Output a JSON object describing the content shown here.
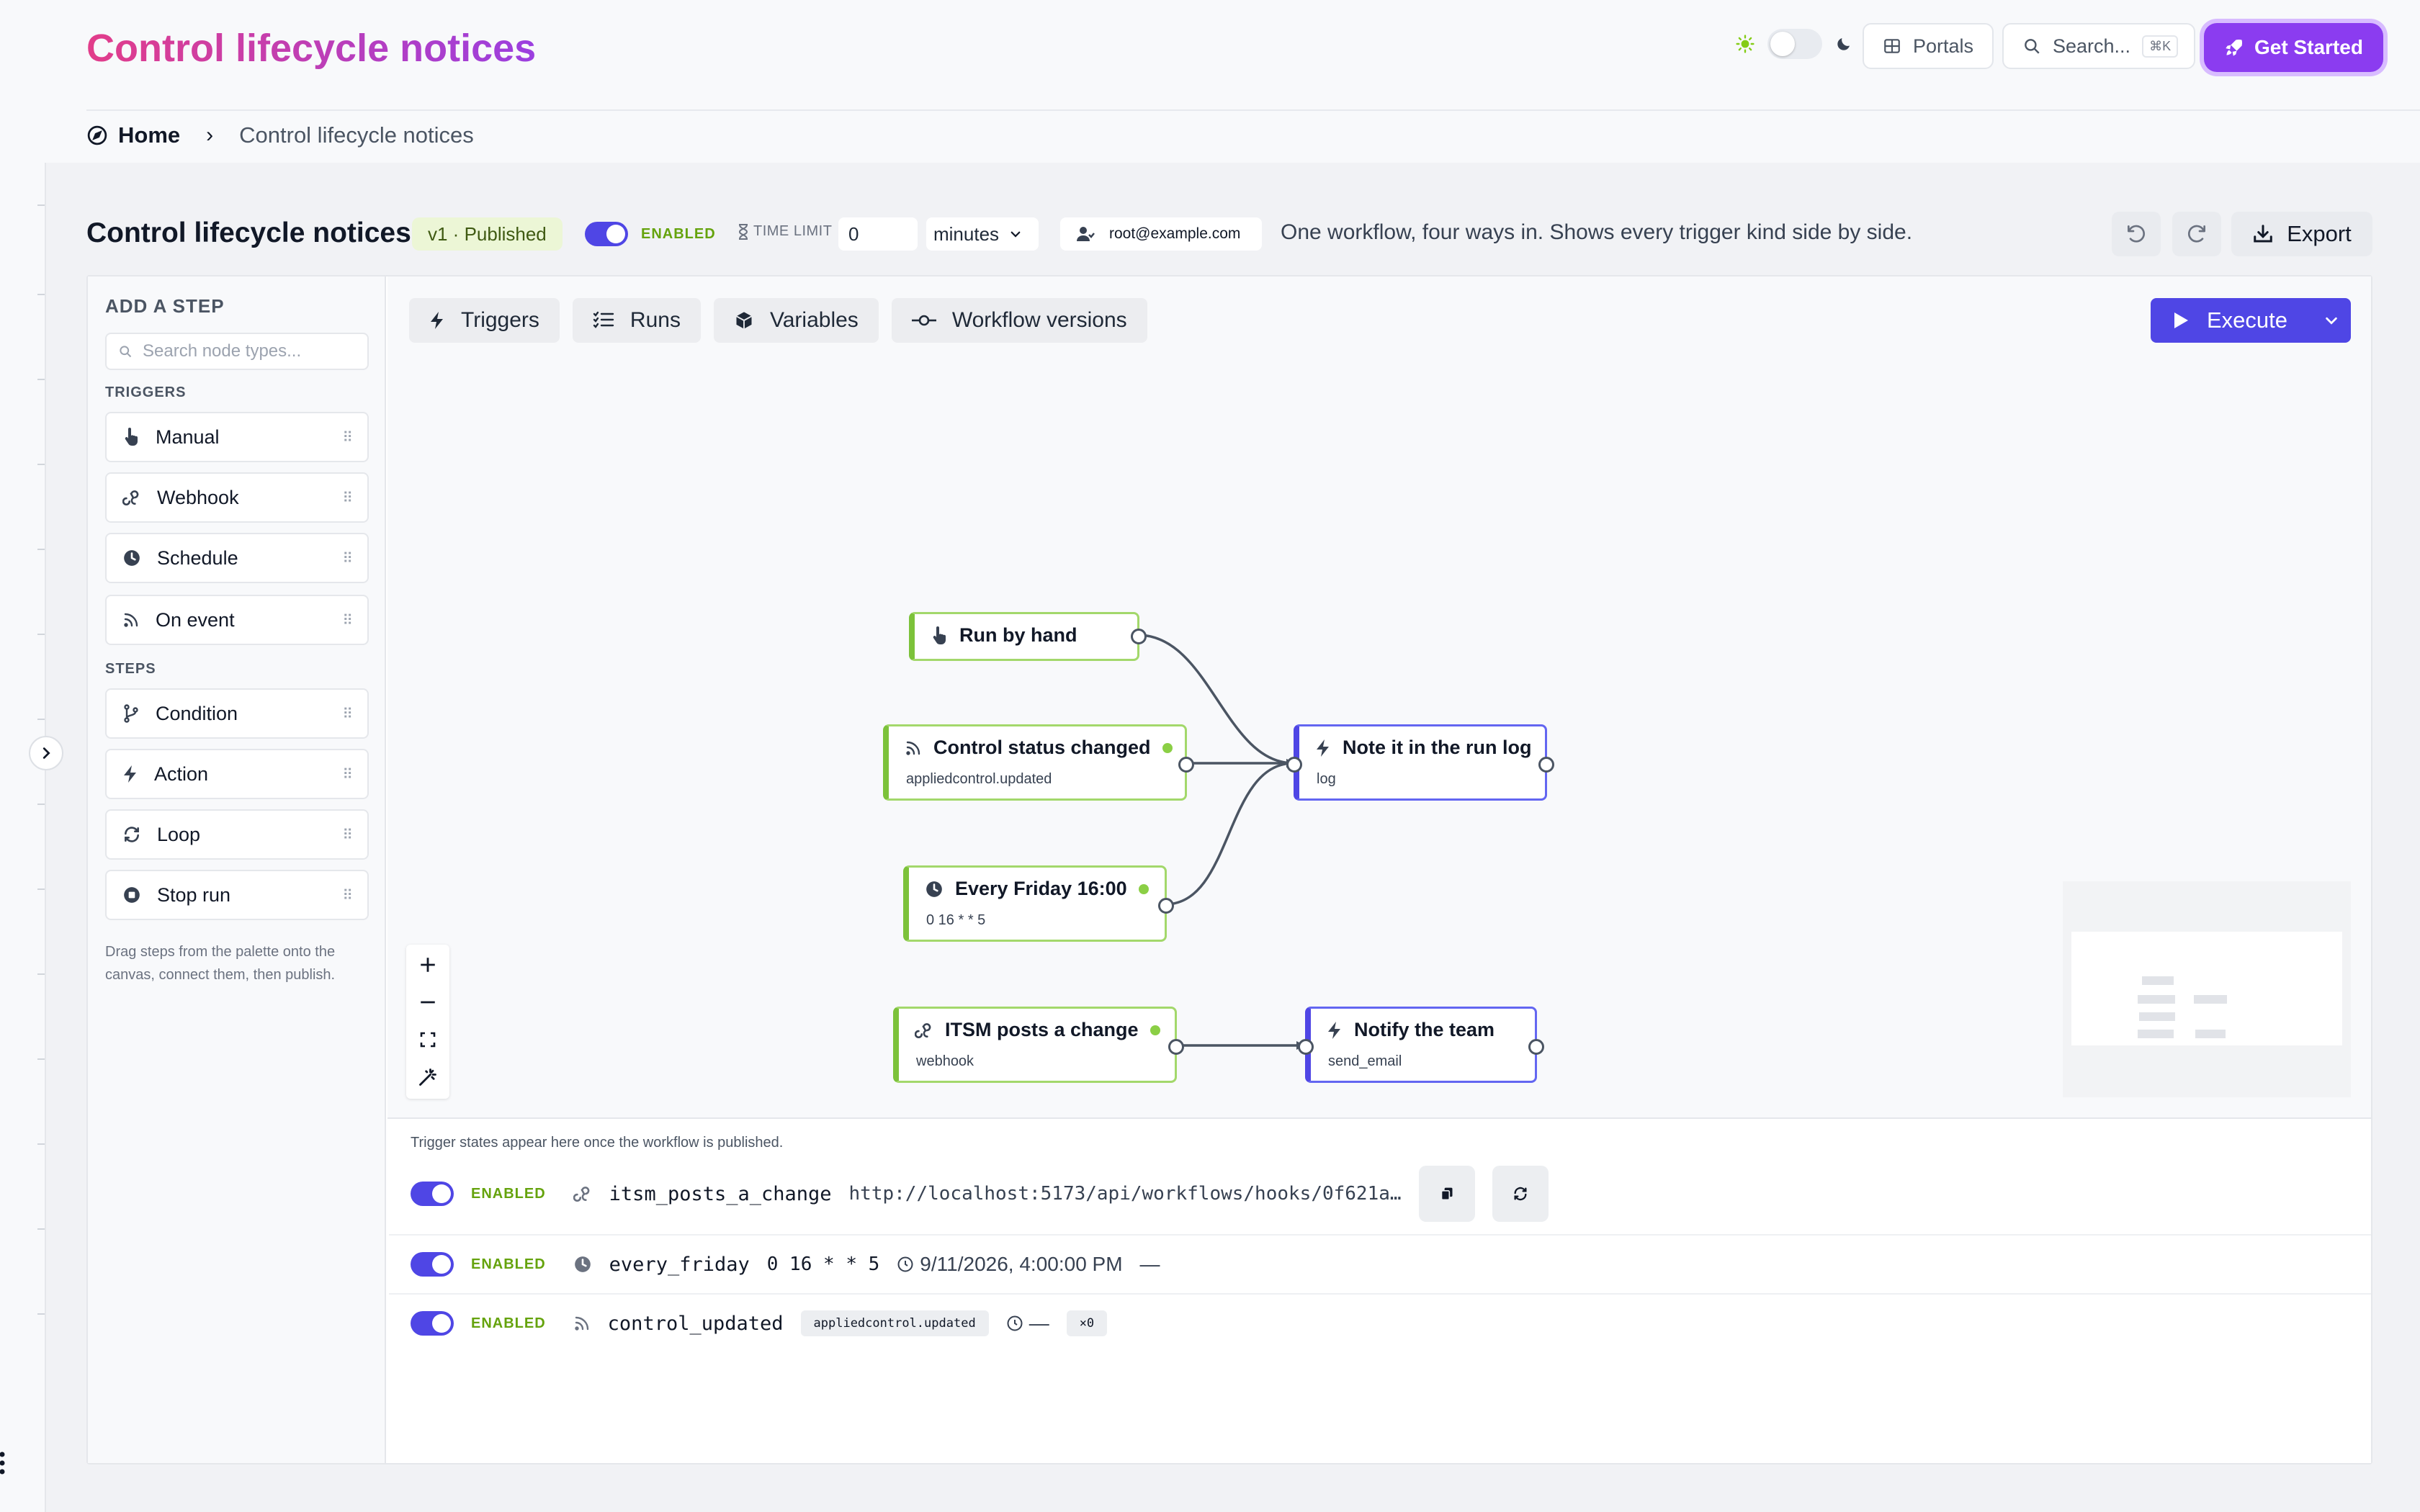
{
  "app": {
    "title": "Control lifecycle notices"
  },
  "header": {
    "portals_label": "Portals",
    "search_label": "Search...",
    "search_shortcut": "⌘K",
    "get_started_label": "Get Started",
    "accent_color": "#8b3cf0"
  },
  "breadcrumb": {
    "home": "Home",
    "current": "Control lifecycle notices"
  },
  "workflow": {
    "title": "Control lifecycle notices",
    "version_badge": "v1 · Published",
    "enabled_label": "ENABLED",
    "time_limit_label": "TIME LIMIT",
    "time_limit_value": "0",
    "time_unit": "minutes",
    "owner": "root@example.com",
    "description": "One workflow, four ways in. Shows every trigger kind side by side.",
    "export_label": "Export"
  },
  "palette": {
    "heading": "ADD A STEP",
    "search_placeholder": "Search node types...",
    "triggers_heading": "TRIGGERS",
    "triggers": [
      {
        "label": "Manual",
        "icon": "hand-pointer-icon"
      },
      {
        "label": "Webhook",
        "icon": "webhook-icon"
      },
      {
        "label": "Schedule",
        "icon": "clock-icon"
      },
      {
        "label": "On event",
        "icon": "rss-icon"
      }
    ],
    "steps_heading": "STEPS",
    "steps": [
      {
        "label": "Condition",
        "icon": "branch-icon"
      },
      {
        "label": "Action",
        "icon": "bolt-icon"
      },
      {
        "label": "Loop",
        "icon": "loop-icon"
      },
      {
        "label": "Stop run",
        "icon": "stop-icon"
      }
    ],
    "footer": "Drag steps from the palette onto the canvas, connect them, then publish."
  },
  "tabs": [
    {
      "label": "Triggers",
      "icon": "bolt-icon"
    },
    {
      "label": "Runs",
      "icon": "checklist-icon"
    },
    {
      "label": "Variables",
      "icon": "cube-icon"
    },
    {
      "label": "Workflow versions",
      "icon": "commit-icon"
    }
  ],
  "execute_label": "Execute",
  "nodes": {
    "run_by_hand": {
      "title": "Run by hand"
    },
    "control_status": {
      "title": "Control status changed",
      "sub": "appliedcontrol.updated"
    },
    "every_friday": {
      "title": "Every Friday 16:00",
      "sub": "0 16 * * 5"
    },
    "note_log": {
      "title": "Note it in the run log",
      "sub": "log"
    },
    "itsm": {
      "title": "ITSM posts a change",
      "sub": "webhook"
    },
    "notify": {
      "title": "Notify the team",
      "sub": "send_email"
    }
  },
  "trigger_states": {
    "note": "Trigger states appear here once the workflow is published.",
    "enabled_label": "ENABLED",
    "rows": [
      {
        "key": "itsm_posts_a_change",
        "url": "http://localhost:5173/api/workflows/hooks/0f621a…"
      },
      {
        "key": "every_friday",
        "cron": "0 16 * * 5",
        "next_run": "9/11/2026, 4:00:00 PM",
        "last": "—"
      },
      {
        "key": "control_updated",
        "event": "appliedcontrol.updated",
        "last": "—",
        "count": "×0"
      }
    ]
  },
  "colors": {
    "primary": "#4f46e5",
    "trigger_green": "#7cc23a",
    "enabled_green": "#65a30d"
  }
}
